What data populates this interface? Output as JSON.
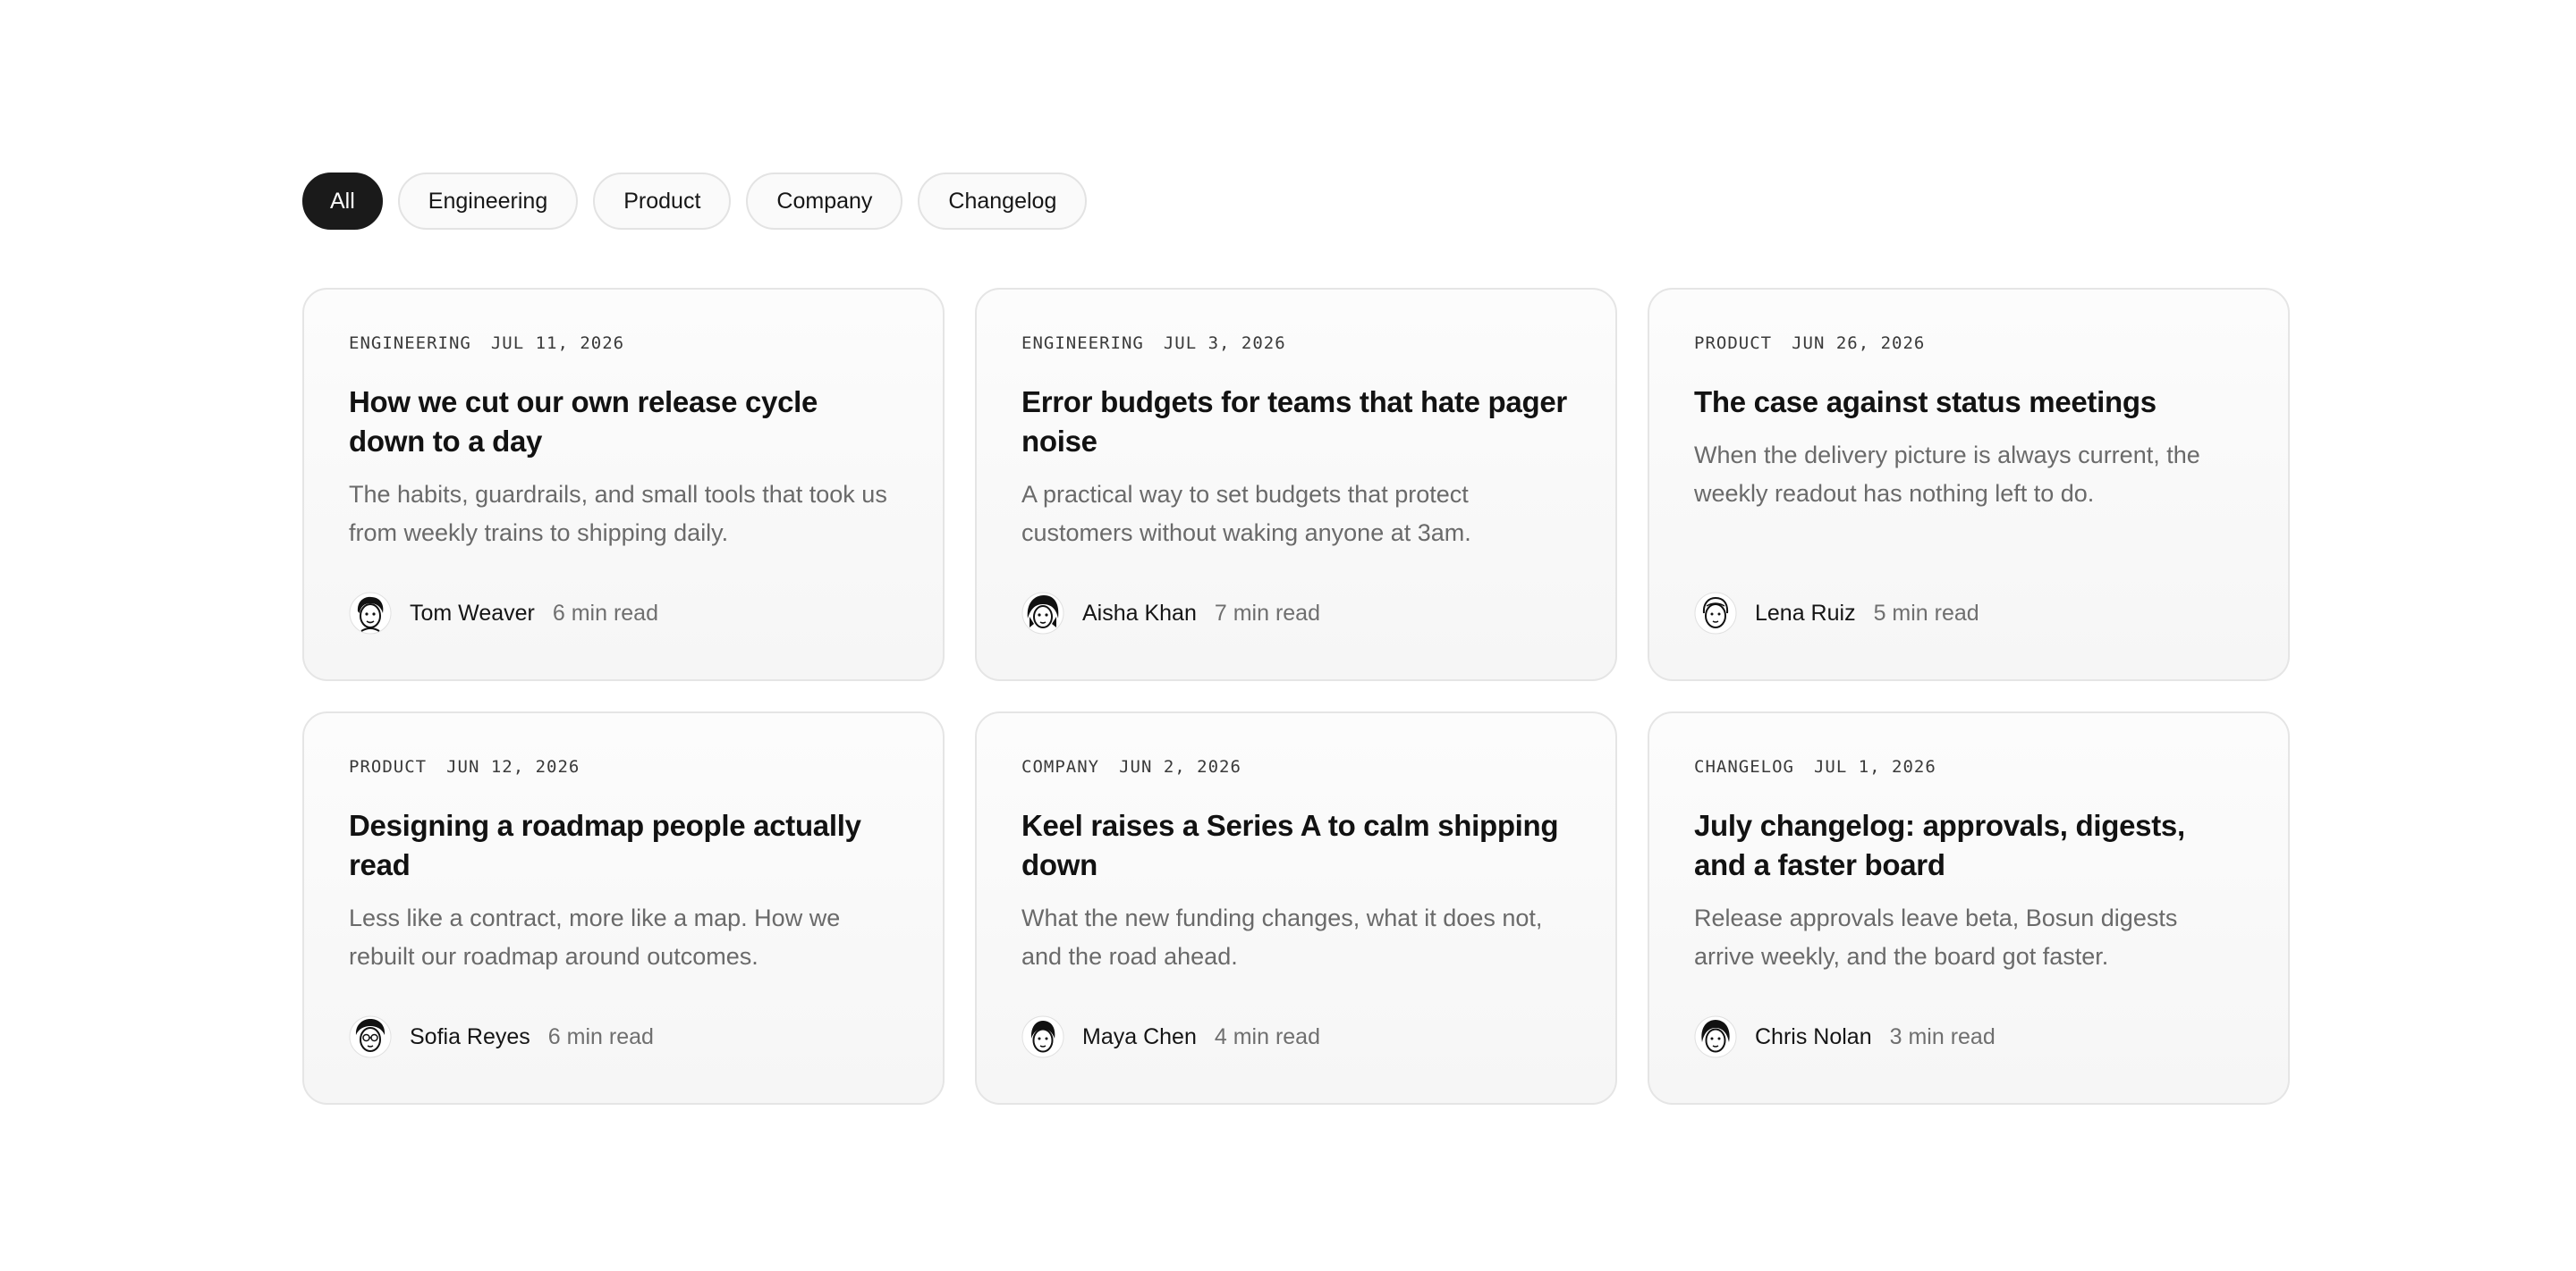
{
  "filters": [
    {
      "label": "All",
      "active": true
    },
    {
      "label": "Engineering",
      "active": false
    },
    {
      "label": "Product",
      "active": false
    },
    {
      "label": "Company",
      "active": false
    },
    {
      "label": "Changelog",
      "active": false
    }
  ],
  "posts": [
    {
      "category": "ENGINEERING",
      "date": "JUL 11, 2026",
      "title": "How we cut our own release cycle down to a day",
      "excerpt": "The habits, guardrails, and small tools that took us from weekly trains to shipping daily.",
      "author": "Tom Weaver",
      "read_time": "6 min read",
      "avatar_icon": "tom-weaver-avatar-icon"
    },
    {
      "category": "ENGINEERING",
      "date": "JUL 3, 2026",
      "title": "Error budgets for teams that hate pager noise",
      "excerpt": "A practical way to set budgets that protect customers without waking anyone at 3am.",
      "author": "Aisha Khan",
      "read_time": "7 min read",
      "avatar_icon": "aisha-khan-avatar-icon"
    },
    {
      "category": "PRODUCT",
      "date": "JUN 26, 2026",
      "title": "The case against status meetings",
      "excerpt": "When the delivery picture is always current, the weekly readout has nothing left to do.",
      "author": "Lena Ruiz",
      "read_time": "5 min read",
      "avatar_icon": "lena-ruiz-avatar-icon"
    },
    {
      "category": "PRODUCT",
      "date": "JUN 12, 2026",
      "title": "Designing a roadmap people actually read",
      "excerpt": "Less like a contract, more like a map. How we rebuilt our roadmap around outcomes.",
      "author": "Sofia Reyes",
      "read_time": "6 min read",
      "avatar_icon": "sofia-reyes-avatar-icon"
    },
    {
      "category": "COMPANY",
      "date": "JUN 2, 2026",
      "title": "Keel raises a Series A to calm shipping down",
      "excerpt": "What the new funding changes, what it does not, and the road ahead.",
      "author": "Maya Chen",
      "read_time": "4 min read",
      "avatar_icon": "maya-chen-avatar-icon"
    },
    {
      "category": "CHANGELOG",
      "date": "JUL 1, 2026",
      "title": "July changelog: approvals, digests, and a faster board",
      "excerpt": "Release approvals leave beta, Bosun digests arrive weekly, and the board got faster.",
      "author": "Chris Nolan",
      "read_time": "3 min read",
      "avatar_icon": "chris-nolan-avatar-icon"
    }
  ],
  "colors": {
    "active_pill": "#1a1a1a",
    "card_border": "#e5e5e5",
    "muted_text": "#6a6a6a"
  }
}
